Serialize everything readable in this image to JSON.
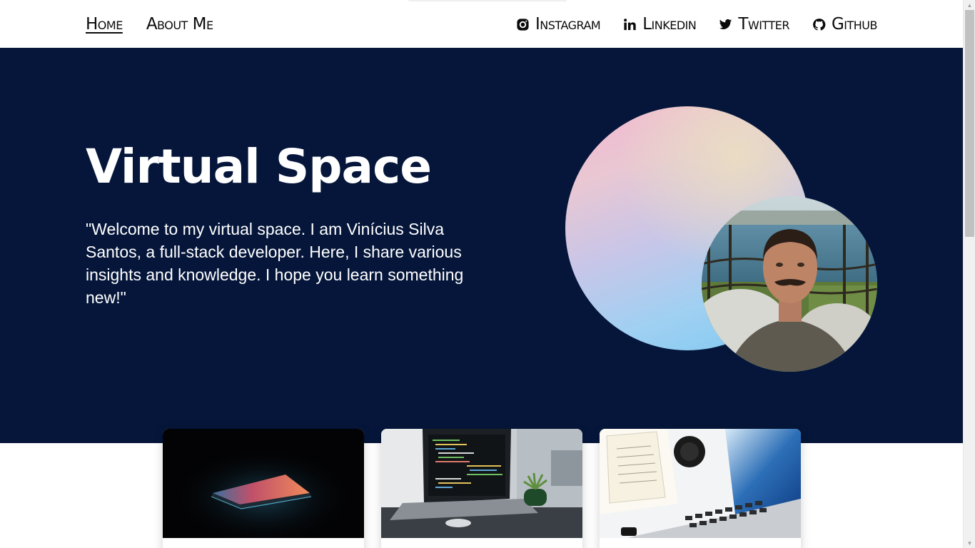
{
  "nav": {
    "left": [
      {
        "label": "Home",
        "active": true
      },
      {
        "label": "About Me",
        "active": false
      }
    ],
    "social": [
      {
        "label": "Instagram",
        "icon": "instagram-icon"
      },
      {
        "label": "Linkedin",
        "icon": "linkedin-icon"
      },
      {
        "label": "Twitter",
        "icon": "twitter-icon"
      },
      {
        "label": "Github",
        "icon": "github-icon"
      }
    ]
  },
  "hero": {
    "title": "Virtual Space",
    "text": "\"Welcome to my virtual space. I am Vinícius Silva Santos, a full-stack developer. Here, I share various insights and knowledge. I hope you learn something new!\"",
    "background_color": "#05163a"
  },
  "cards": [
    {
      "image": "laptop-glow-image"
    },
    {
      "image": "laptop-code-image"
    },
    {
      "image": "desk-laptop-image"
    }
  ]
}
